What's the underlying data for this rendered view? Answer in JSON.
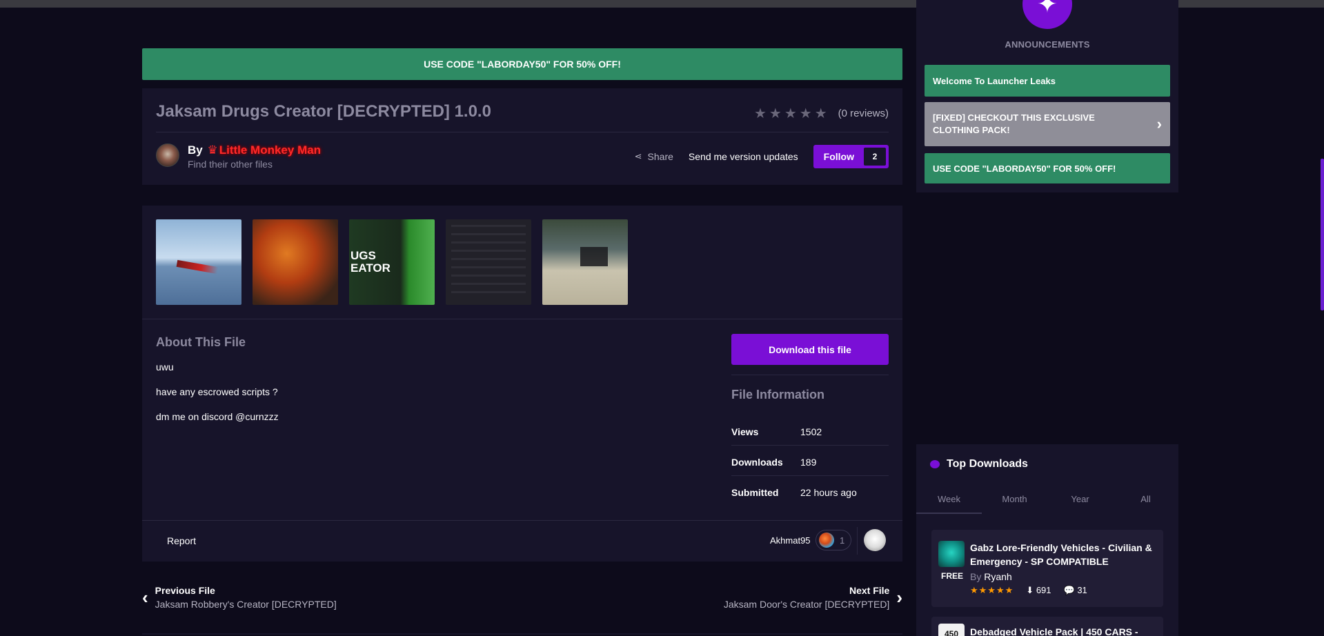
{
  "promo_banner": "USE CODE \"LABORDAY50\" FOR 50% OFF!",
  "file": {
    "title": "Jaksam Drugs Creator [DECRYPTED] 1.0.0",
    "reviews": "(0 reviews)",
    "author_prefix": "By",
    "author_name": "Little Monkey Man",
    "find_files": "Find their other files",
    "share_label": "Share",
    "updates_label": "Send me version updates",
    "follow_label": "Follow",
    "follow_count": "2",
    "thumb3_text": "UGS\nEATOR",
    "about_title": "About This File",
    "about_lines": [
      "uwu",
      "have any escrowed scripts ?",
      "dm me on discord @curnzzz"
    ],
    "download_label": "Download this file",
    "info_title": "File Information",
    "info": [
      {
        "key": "Views",
        "value": "1502"
      },
      {
        "key": "Downloads",
        "value": "189"
      },
      {
        "key": "Submitted",
        "value": "22 hours ago"
      }
    ],
    "report_label": "Report",
    "reaction_user": "Akhmat95",
    "reaction_count": "1"
  },
  "nav": {
    "prev_label": "Previous File",
    "prev_file": "Jaksam Robbery's Creator [DECRYPTED]",
    "next_label": "Next File",
    "next_file": "Jaksam Door's Creator [DECRYPTED]"
  },
  "sidebar": {
    "announcements_title": "ANNOUNCEMENTS",
    "announcements": [
      "Welcome To Launcher Leaks",
      "[FIXED] CHECKOUT THIS EXCLUSIVE CLOTHING PACK!",
      "USE CODE \"LABORDAY50\" FOR 50% OFF!"
    ],
    "top_downloads_title": "Top Downloads",
    "tabs": [
      "Week",
      "Month",
      "Year",
      "All"
    ],
    "top_item": {
      "title": "Gabz Lore-Friendly Vehicles - Civilian & Emergency - SP COMPATIBLE",
      "badge": "FREE",
      "by_prefix": "By",
      "author": "Ryanh",
      "downloads": "691",
      "comments": "31"
    },
    "second_item": {
      "thumb_text": "450",
      "title": "Debadged Vehicle Pack | 450 CARS -"
    }
  },
  "colors": {
    "background": "#0d0b1b",
    "card": "#17142a",
    "accent_purple": "#7a0fd6",
    "accent_green": "#2e8b64"
  }
}
